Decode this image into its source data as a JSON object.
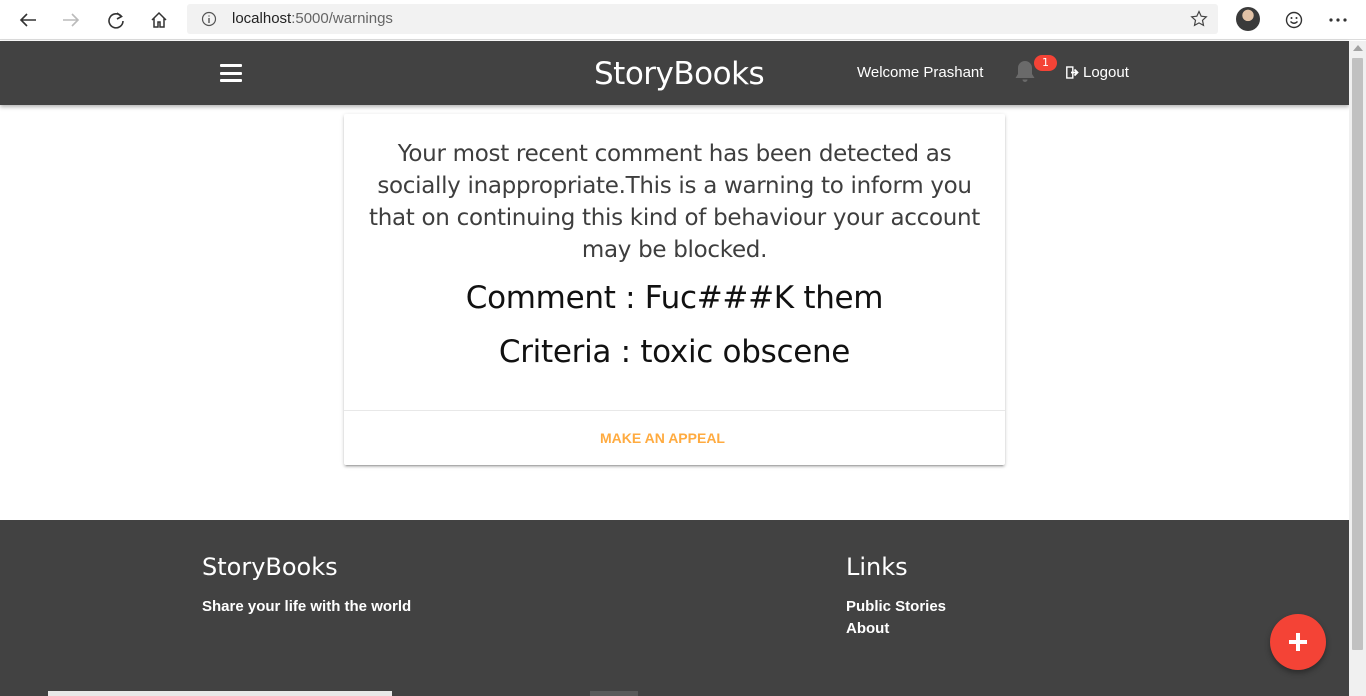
{
  "browser": {
    "url_host": "localhost",
    "url_rest": ":5000/warnings"
  },
  "navbar": {
    "brand": "StoryBooks",
    "welcome": "Welcome Prashant",
    "notification_count": "1",
    "logout_label": "Logout"
  },
  "warning": {
    "message": "Your most recent comment has been detected as socially inappropriate.This is a warning to inform you that on continuing this kind of behaviour your account may be blocked.",
    "comment": "Comment : Fuc###K them",
    "criteria": "Criteria : toxic obscene",
    "appeal_label": "MAKE AN APPEAL"
  },
  "footer": {
    "brand_title": "StoryBooks",
    "tagline": "Share your life with the world",
    "links_title": "Links",
    "links": [
      "Public Stories",
      "About"
    ]
  },
  "colors": {
    "navbar_bg": "#424242",
    "accent_orange": "#ffab40",
    "fab_red": "#f44336"
  },
  "icons": {
    "back": "arrow-left-icon",
    "forward": "arrow-right-icon",
    "refresh": "refresh-icon",
    "home": "home-icon",
    "info": "info-icon",
    "favorite": "star-icon",
    "feedback": "smiley-icon",
    "more": "more-dots-icon",
    "menu": "hamburger-icon",
    "notifications": "bell-icon",
    "logout": "logout-icon",
    "add": "plus-icon"
  }
}
